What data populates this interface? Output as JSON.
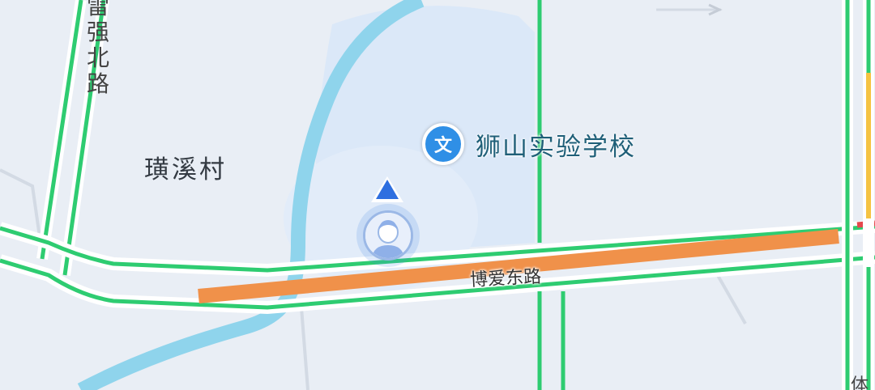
{
  "map": {
    "area_label": "璜溪村",
    "poi": {
      "icon_glyph": "文",
      "icon": "school-icon",
      "name": "狮山实验学校"
    },
    "roads": {
      "vertical_road_name": "雷强北路",
      "horizontal_road_name": "博爱东路",
      "corner_fragment": "体"
    },
    "traffic": {
      "smooth": "#2ecc71",
      "slow": "#f0914a",
      "jam": "#e5484d",
      "caution": "#f5c342"
    },
    "colors": {
      "background": "#e9eef5",
      "water": "#8fd4ec",
      "campus": "#dbe8f8"
    },
    "user_marker": {
      "icon": "user-location-icon",
      "heading_icon": "heading-arrow-icon"
    }
  }
}
